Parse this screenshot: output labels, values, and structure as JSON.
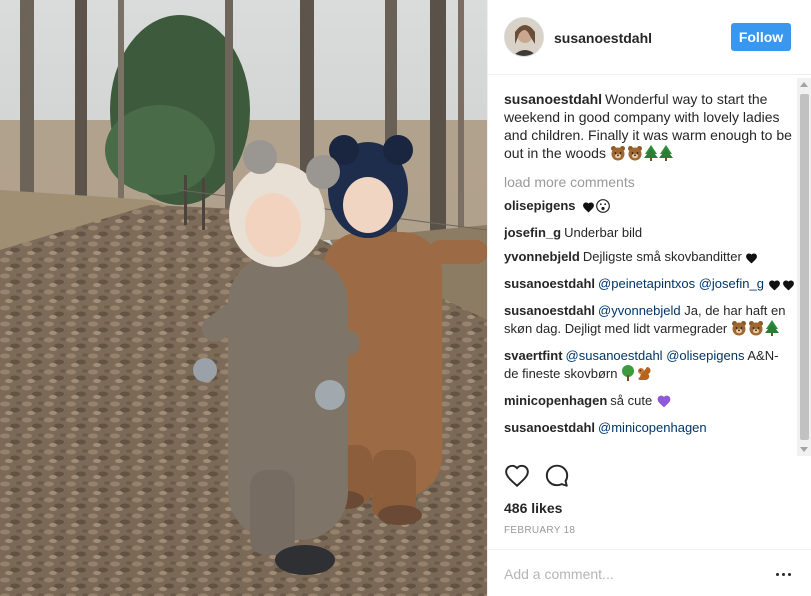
{
  "post": {
    "image_alt": "",
    "author": "susanoestdahl",
    "follow_label": "Follow",
    "caption": {
      "username": "susanoestdahl",
      "text": "Wonderful way to start the weekend in good company with lovely ladies and children. Finally it was warm enough to be out in the woods",
      "emojis": [
        "bear-emoji",
        "bear-emoji",
        "evergreen-tree-emoji",
        "evergreen-tree-emoji"
      ]
    },
    "load_more_label": "load more comments",
    "comments": [
      {
        "username": "olisepigens",
        "parts": [],
        "emojis": [
          "black-heart-emoji",
          "surprised-face-emoji"
        ]
      },
      {
        "username": "josefin_g",
        "parts": [
          {
            "t": "Underbar bild"
          }
        ],
        "emojis": []
      },
      {
        "username": "yvonnebjeld",
        "parts": [
          {
            "t": "Dejligste små skovbanditter"
          }
        ],
        "emojis": [
          "black-heart-emoji"
        ]
      },
      {
        "username": "susanoestdahl",
        "parts": [
          {
            "m": "@peinetapintxos"
          },
          {
            "t": " "
          },
          {
            "m": "@josefin_g"
          }
        ],
        "emojis": [
          "black-heart-emoji",
          "black-heart-emoji"
        ]
      },
      {
        "username": "susanoestdahl",
        "parts": [
          {
            "m": "@yvonnebjeld"
          },
          {
            "t": " Ja, de har haft en skøn dag. Dejligt med lidt varmegrader"
          }
        ],
        "emojis": [
          "bear-emoji",
          "bear-emoji",
          "evergreen-tree-emoji"
        ]
      },
      {
        "username": "svaertfint",
        "parts": [
          {
            "m": "@susanoestdahl"
          },
          {
            "t": " "
          },
          {
            "m": "@olisepigens"
          },
          {
            "t": " A&N- de fineste skovbørn"
          }
        ],
        "emojis": [
          "deciduous-tree-emoji",
          "squirrel-emoji"
        ]
      },
      {
        "username": "minicopenhagen",
        "parts": [
          {
            "t": "så cute"
          }
        ],
        "emojis": [
          "purple-heart-emoji"
        ]
      },
      {
        "username": "susanoestdahl",
        "parts": [
          {
            "m": "@minicopenhagen"
          }
        ],
        "emojis": []
      }
    ],
    "likes_text": "486 likes",
    "date_text": "FEBRUARY 18",
    "comment_placeholder": "Add a comment...",
    "icons": {
      "like": "heart-icon",
      "comment": "comment-bubble-icon",
      "more": "more-options-icon"
    },
    "colors": {
      "follow_button": "#3897f0",
      "mention": "#003569",
      "muted": "#999999",
      "text": "#262626"
    }
  }
}
